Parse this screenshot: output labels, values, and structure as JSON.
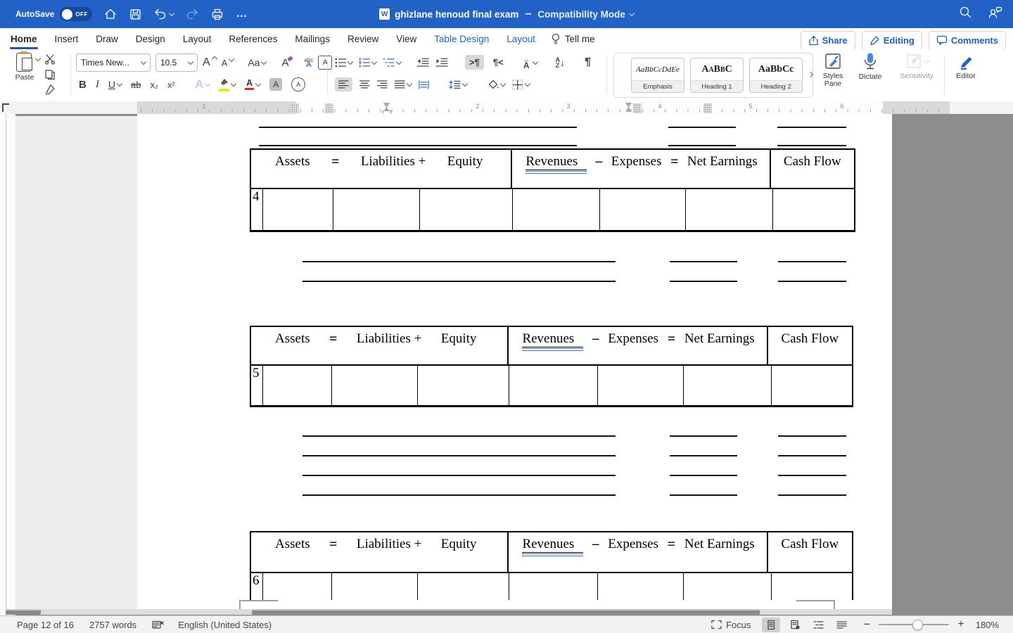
{
  "colors": {
    "titlebar_blue": "#2262c6",
    "accent_blue": "#1a5fc8",
    "contextual_tab_blue": "#1a63c9",
    "table_border": "#000000",
    "grammar_underline_blue": "#2f6fd0",
    "highlight_yellow": "#f3e11a",
    "font_color_red": "#d93025"
  },
  "titlebar": {
    "autosave_label": "AutoSave",
    "autosave_state": "OFF",
    "doc_title": "ghizlane henoud final exam",
    "title_separator": "–",
    "mode_label": "Compatibility Mode"
  },
  "tabs": {
    "items": [
      "Home",
      "Insert",
      "Draw",
      "Design",
      "Layout",
      "References",
      "Mailings",
      "Review",
      "View"
    ],
    "contextual": [
      "Table Design",
      "Layout"
    ],
    "tellme_label": "Tell me"
  },
  "actions": {
    "share": "Share",
    "editing": "Editing",
    "comments": "Comments"
  },
  "ribbon": {
    "paste_label": "Paste",
    "font_name": "Times New...",
    "font_size": "10.5",
    "bold": "B",
    "italic": "I",
    "underline": "U",
    "strike": "ab",
    "subscript": "x₂",
    "superscript": "x²",
    "grow_font": "A",
    "shrink_font": "A",
    "change_case": "Aa",
    "styles": [
      {
        "preview": "AaBbCcDdEe",
        "label": "Emphasis"
      },
      {
        "preview": "AaBbC",
        "label": "Heading 1"
      },
      {
        "preview": "AaBbCc",
        "label": "Heading 2"
      }
    ],
    "styles_pane_label": "Styles Pane",
    "dictate_label": "Dictate",
    "sensitivity_label": "Sensitivity",
    "editor_label": "Editor"
  },
  "ruler": {
    "numbers": [
      "1",
      "2",
      "3",
      "4",
      "5",
      "6"
    ]
  },
  "document": {
    "header": {
      "assets": "Assets",
      "eq1": "=",
      "liabilities": "Liabilities +",
      "equity": "Equity",
      "revenues": "Revenues",
      "minus": "–",
      "expenses": "Expenses",
      "eq2": "=",
      "net_earnings": "Net Earnings",
      "cash_flow": "Cash Flow"
    },
    "rows": [
      "4",
      "5",
      "6"
    ]
  },
  "statusbar": {
    "page": "Page 12 of 16",
    "words": "2757 words",
    "language": "English (United States)",
    "focus": "Focus",
    "zoom": "180%"
  }
}
